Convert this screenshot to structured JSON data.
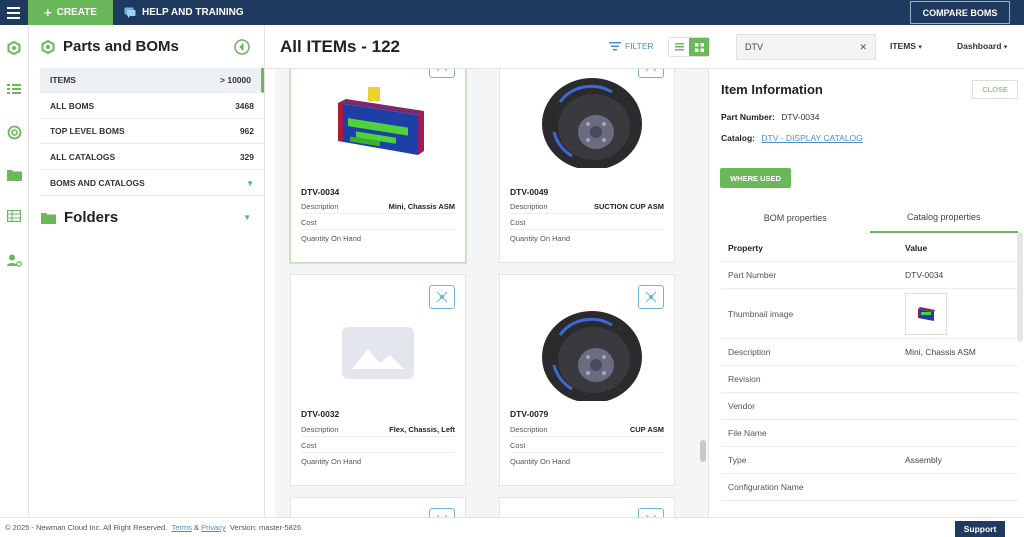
{
  "topbar": {
    "create_label": "CREATE",
    "help_label": "HELP AND TRAINING",
    "compare_label": "COMPARE BOMS"
  },
  "sidebar": {
    "title": "Parts and BOMs",
    "items": [
      {
        "label": "ITEMS",
        "count": "> 10000"
      },
      {
        "label": "ALL BOMS",
        "count": "3468"
      },
      {
        "label": "TOP LEVEL BOMS",
        "count": "962"
      },
      {
        "label": "ALL CATALOGS",
        "count": "329"
      },
      {
        "label": "BOMS AND CATALOGS",
        "count": ""
      }
    ],
    "folders_title": "Folders"
  },
  "main": {
    "title": "All ITEMs - 122",
    "filter_label": "FILTER",
    "search_value": "DTV",
    "items_dropdown": "ITEMS",
    "dashboard_dropdown": "Dashboard"
  },
  "cards": [
    {
      "part_number": "DTV-0034",
      "description_label": "Description",
      "description": "Mini, Chassis ASM",
      "cost_label": "Cost",
      "qoh_label": "Quantity On Hand"
    },
    {
      "part_number": "DTV-0049",
      "description_label": "Description",
      "description": "SUCTION CUP ASM",
      "cost_label": "Cost",
      "qoh_label": "Quantity On Hand"
    },
    {
      "part_number": "DTV-0032",
      "description_label": "Description",
      "description": "Flex, Chassis, Left",
      "cost_label": "Cost",
      "qoh_label": "Quantity On Hand"
    },
    {
      "part_number": "DTV-0079",
      "description_label": "Description",
      "description": "CUP ASM",
      "cost_label": "Cost",
      "qoh_label": "Quantity On Hand"
    }
  ],
  "info": {
    "title": "Item Information",
    "close_label": "CLOSE",
    "part_number_label": "Part Number:",
    "part_number": "DTV-0034",
    "catalog_label": "Catalog:",
    "catalog": "DTV - DISPLAY CATALOG",
    "where_used_label": "WHERE USED",
    "tabs": [
      "BOM properties",
      "Catalog properties"
    ],
    "table_headers": {
      "property": "Property",
      "value": "Value"
    },
    "properties": [
      {
        "name": "Part Number",
        "value": "DTV-0034"
      },
      {
        "name": "Thumbnail image",
        "value": ""
      },
      {
        "name": "Description",
        "value": "Mini, Chassis ASM"
      },
      {
        "name": "Revision",
        "value": ""
      },
      {
        "name": "Vendor",
        "value": ""
      },
      {
        "name": "File Name",
        "value": ""
      },
      {
        "name": "Type",
        "value": "Assembly"
      },
      {
        "name": "Configuration Name",
        "value": ""
      }
    ]
  },
  "footer": {
    "copyright": "© 2025 - Newman Cloud Inc. All Right Reserved.",
    "terms": "Terms",
    "amp": "&",
    "privacy": "Privacy",
    "version": "Version: master-5826",
    "support_label": "Support"
  },
  "colors": {
    "topbar": "#1f3a5f",
    "accent_green": "#6bb85a",
    "link_blue": "#4a90c8"
  }
}
